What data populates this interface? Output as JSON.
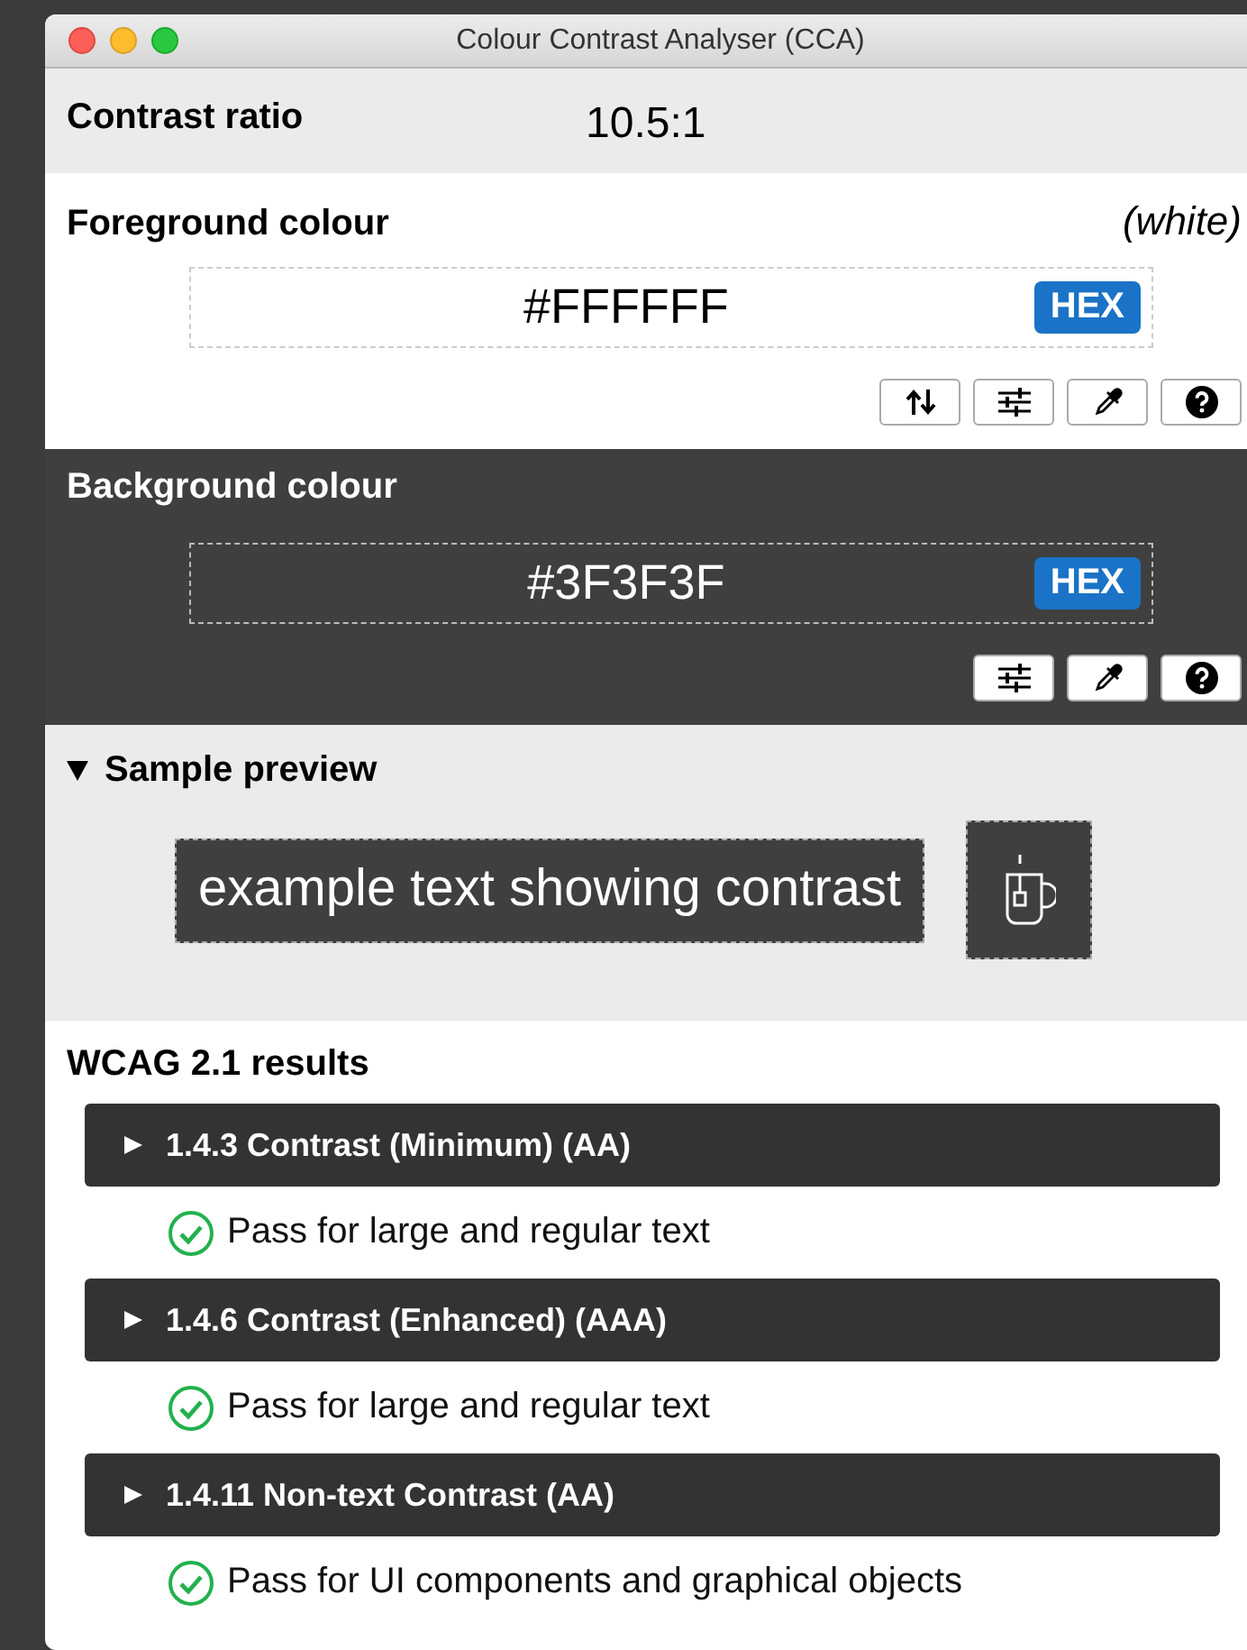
{
  "window": {
    "title": "Colour Contrast Analyser (CCA)"
  },
  "contrast": {
    "label": "Contrast ratio",
    "value": "10.5:1"
  },
  "foreground": {
    "label": "Foreground colour",
    "name": "(white)",
    "value": "#FFFFFF",
    "format": "HEX",
    "color": "#ffffff",
    "tools": [
      {
        "kind": "swap"
      },
      {
        "kind": "sliders"
      },
      {
        "kind": "picker"
      },
      {
        "kind": "help"
      }
    ]
  },
  "background": {
    "label": "Background colour",
    "value": "#3F3F3F",
    "format": "HEX",
    "color": "#3f3f3f",
    "tools": [
      {
        "kind": "sliders"
      },
      {
        "kind": "picker"
      },
      {
        "kind": "help"
      }
    ]
  },
  "sample": {
    "label": "Sample preview",
    "expanded": true,
    "text": "example text showing contrast"
  },
  "results": {
    "title": "WCAG 2.1 results",
    "items": [
      {
        "heading": "1.4.3 Contrast (Minimum) (AA)",
        "expanded": false,
        "passed": true,
        "text": "Pass for large and regular text"
      },
      {
        "heading": "1.4.6 Contrast (Enhanced) (AAA)",
        "expanded": false,
        "passed": true,
        "text": "Pass for large and regular text"
      },
      {
        "heading": "1.4.11 Non-text Contrast (AA)",
        "expanded": false,
        "passed": true,
        "text": "Pass for UI components and graphical objects"
      }
    ]
  }
}
